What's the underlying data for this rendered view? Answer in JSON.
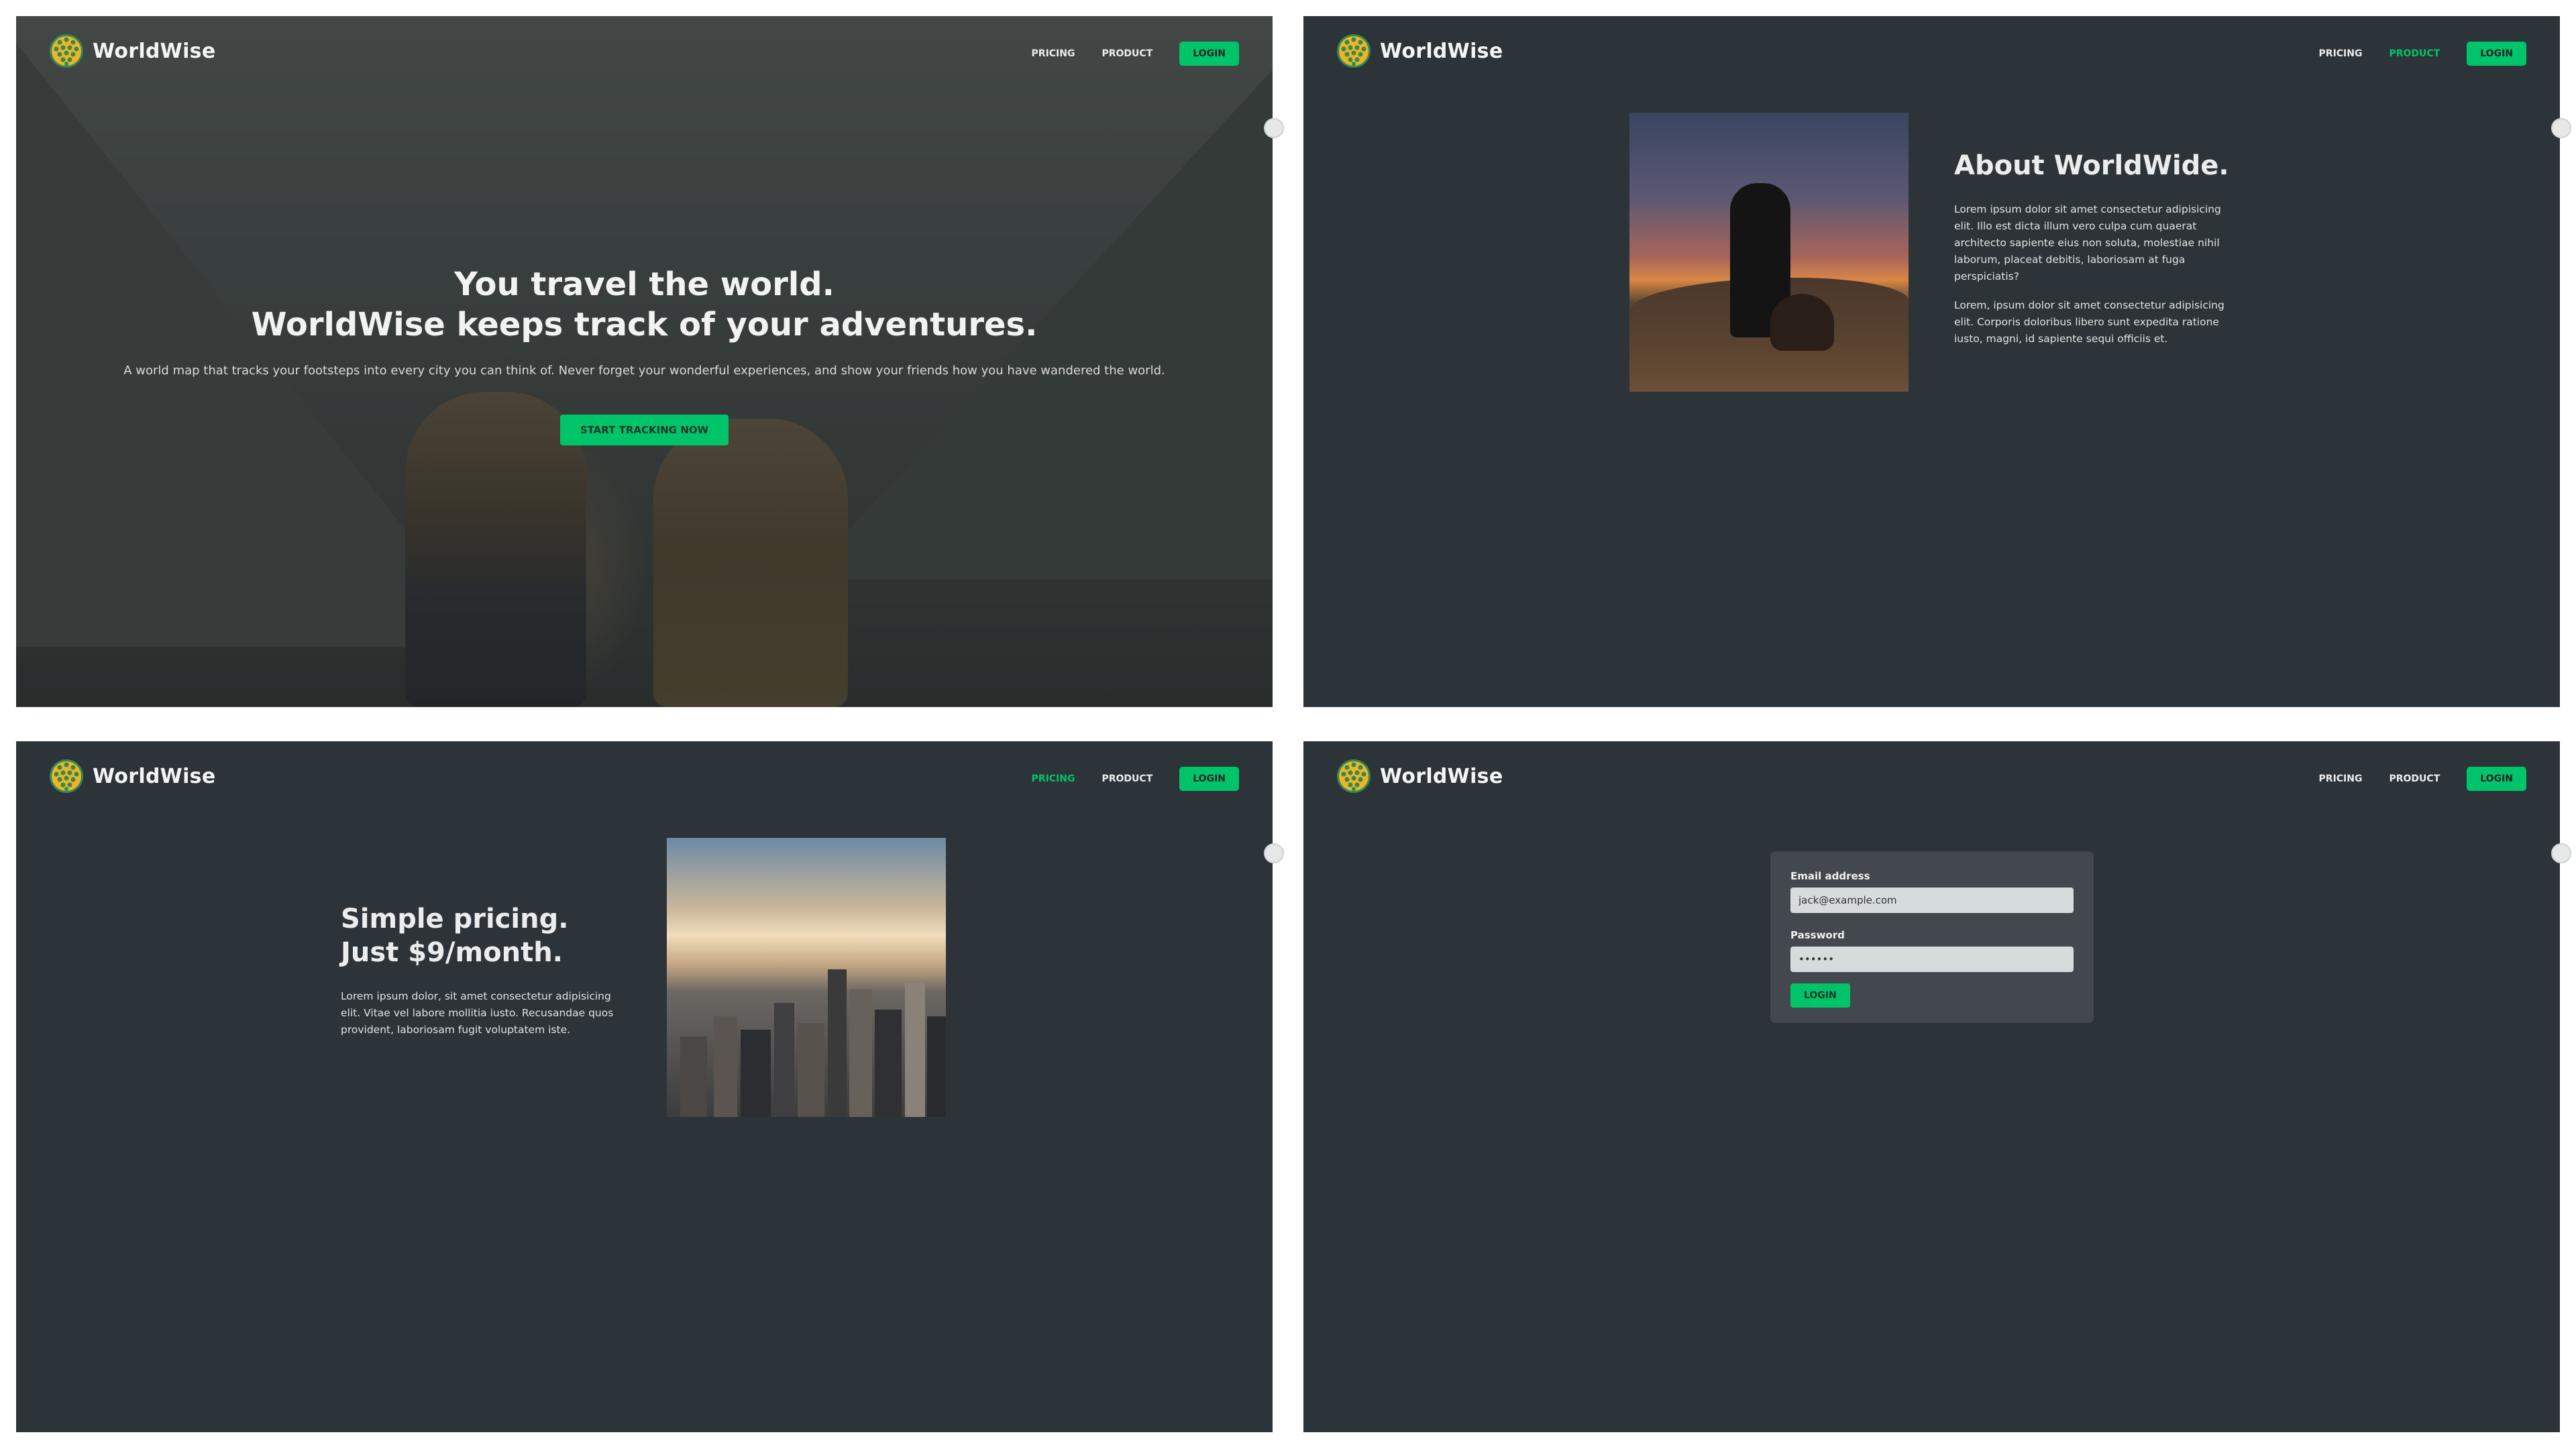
{
  "brand": {
    "name": "WorldWise",
    "logo_icon": "globe-dots-icon"
  },
  "nav": {
    "pricing": "PRICING",
    "product": "PRODUCT",
    "login": "LOGIN"
  },
  "colors": {
    "accent": "#00c46a",
    "background": "#2d3439"
  },
  "home": {
    "headline_line1": "You travel the world.",
    "headline_line2": "WorldWise keeps track of your adventures.",
    "subtitle": "A world map that tracks your footsteps into every city you can think of. Never forget your wonderful experiences, and show your friends how you have wandered the world.",
    "cta": "START TRACKING NOW"
  },
  "product": {
    "title": "About WorldWide.",
    "p1": "Lorem ipsum dolor sit amet consectetur adipisicing elit. Illo est dicta illum vero culpa cum quaerat architecto sapiente eius non soluta, molestiae nihil laborum, placeat debitis, laboriosam at fuga perspiciatis?",
    "p2": "Lorem, ipsum dolor sit amet consectetur adipisicing elit. Corporis doloribus libero sunt expedita ratione iusto, magni, id sapiente sequi officiis et."
  },
  "pricing": {
    "title_line1": "Simple pricing.",
    "title_line2": "Just $9/month.",
    "body": "Lorem ipsum dolor, sit amet consectetur adipisicing elit. Vitae vel labore mollitia iusto. Recusandae quos provident, laboriosam fugit voluptatem iste."
  },
  "login": {
    "email_label": "Email address",
    "email_value": "jack@example.com",
    "password_label": "Password",
    "password_value": "qwerty",
    "submit": "LOGIN"
  }
}
